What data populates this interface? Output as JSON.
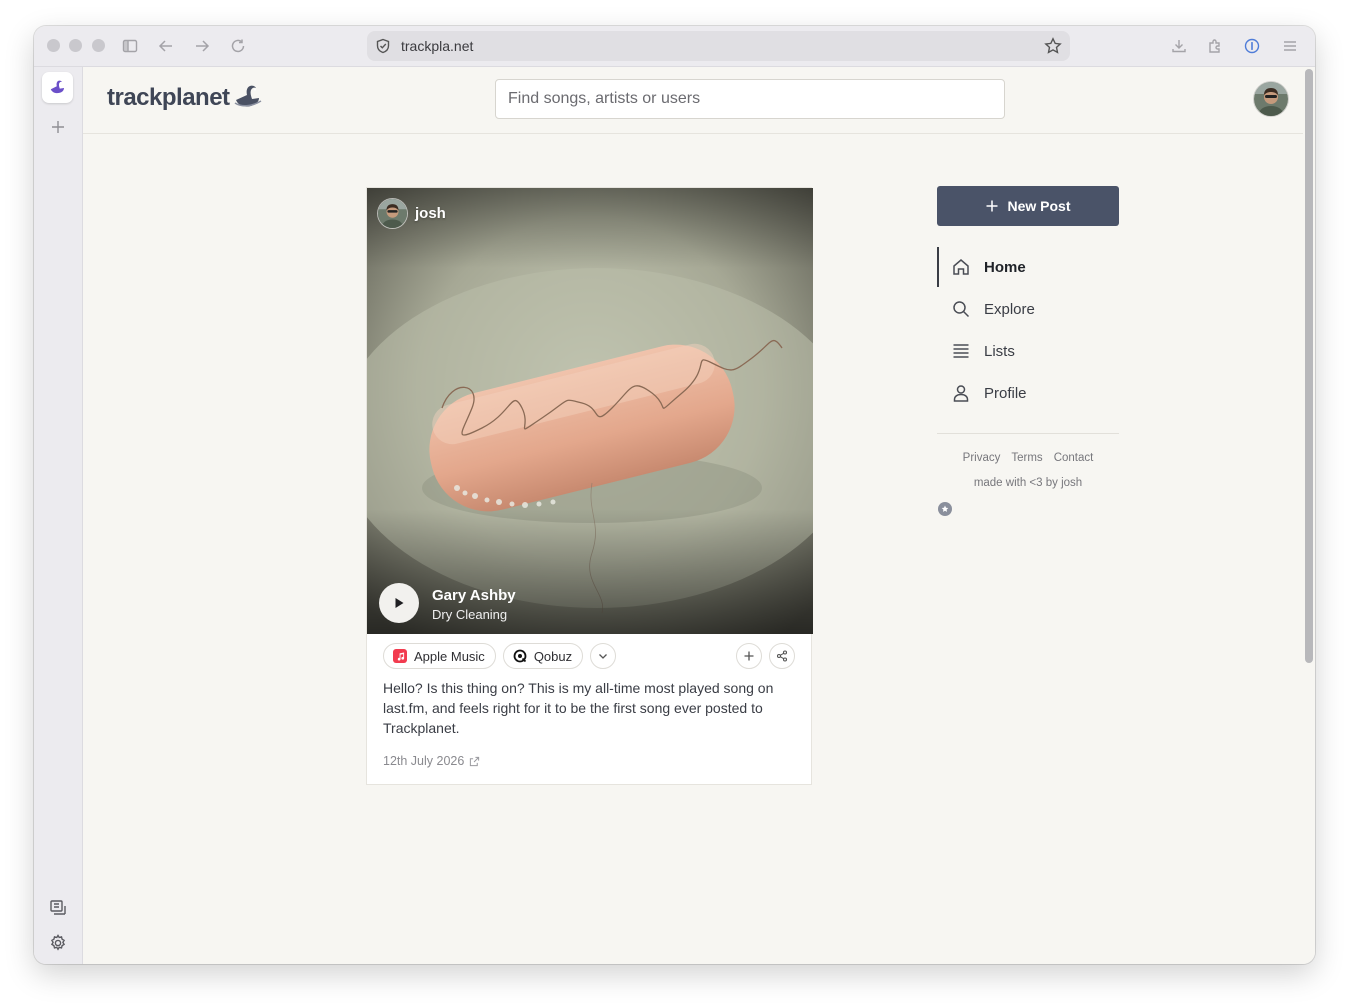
{
  "browser": {
    "url": "trackpla.net"
  },
  "header": {
    "logo_text": "trackplanet",
    "search_placeholder": "Find songs, artists or users"
  },
  "post": {
    "username": "josh",
    "track_title": "Gary Ashby",
    "track_album": "Dry Cleaning",
    "services": [
      {
        "label": "Apple Music",
        "color": "#f23b4f"
      },
      {
        "label": "Qobuz",
        "color": "#111111"
      }
    ],
    "caption": "Hello? Is this thing on? This is my all-time most played song on last.fm, and feels right for it to be the first song ever posted to Trackplanet.",
    "date": "12th July 2026"
  },
  "sidebar": {
    "new_post_label": "New Post",
    "nav": [
      {
        "label": "Home",
        "icon": "home-icon",
        "active": true
      },
      {
        "label": "Explore",
        "icon": "search-icon",
        "active": false
      },
      {
        "label": "Lists",
        "icon": "list-icon",
        "active": false
      },
      {
        "label": "Profile",
        "icon": "user-icon",
        "active": false
      }
    ],
    "footer_links": [
      "Privacy",
      "Terms",
      "Contact"
    ],
    "made_with": "made with <3 by josh"
  },
  "colors": {
    "accent": "#4a5368",
    "page_bg": "#f7f6f2"
  }
}
